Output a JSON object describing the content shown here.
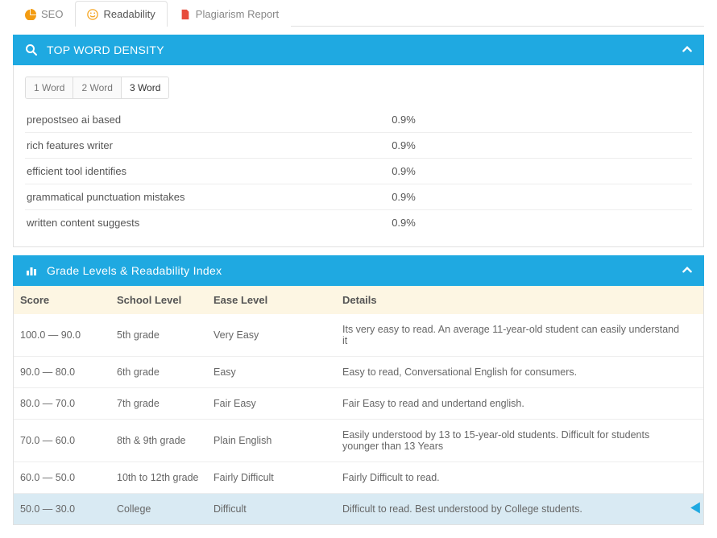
{
  "tabs": {
    "seo": "SEO",
    "readability": "Readability",
    "plagiarism": "Plagiarism Report"
  },
  "density": {
    "title": "TOP WORD DENSITY",
    "subtabs": {
      "w1": "1 Word",
      "w2": "2 Word",
      "w3": "3 Word"
    },
    "rows": [
      {
        "term": "prepostseo ai based",
        "pct": "0.9%"
      },
      {
        "term": "rich features writer",
        "pct": "0.9%"
      },
      {
        "term": "efficient tool identifies",
        "pct": "0.9%"
      },
      {
        "term": "grammatical punctuation mistakes",
        "pct": "0.9%"
      },
      {
        "term": "written content suggests",
        "pct": "0.9%"
      }
    ]
  },
  "grade": {
    "title": "Grade Levels & Readability Index",
    "headers": {
      "score": "Score",
      "school": "School Level",
      "ease": "Ease Level",
      "details": "Details"
    },
    "rows": [
      {
        "score": "100.0 — 90.0",
        "school": "5th grade",
        "ease": "Very Easy",
        "details": "Its very easy to read. An average 11-year-old student can easily understand it"
      },
      {
        "score": "90.0 — 80.0",
        "school": "6th grade",
        "ease": "Easy",
        "details": "Easy to read, Conversational English for consumers."
      },
      {
        "score": "80.0 — 70.0",
        "school": "7th grade",
        "ease": "Fair Easy",
        "details": "Fair Easy to read and undertand english."
      },
      {
        "score": "70.0 — 60.0",
        "school": "8th & 9th grade",
        "ease": "Plain English",
        "details": "Easily understood by 13 to 15-year-old students. Difficult for students younger than 13 Years"
      },
      {
        "score": "60.0 — 50.0",
        "school": "10th to 12th grade",
        "ease": "Fairly Difficult",
        "details": "Fairly Difficult to read."
      },
      {
        "score": "50.0 — 30.0",
        "school": "College",
        "ease": "Difficult",
        "details": "Difficult to read. Best understood by College students."
      }
    ]
  }
}
